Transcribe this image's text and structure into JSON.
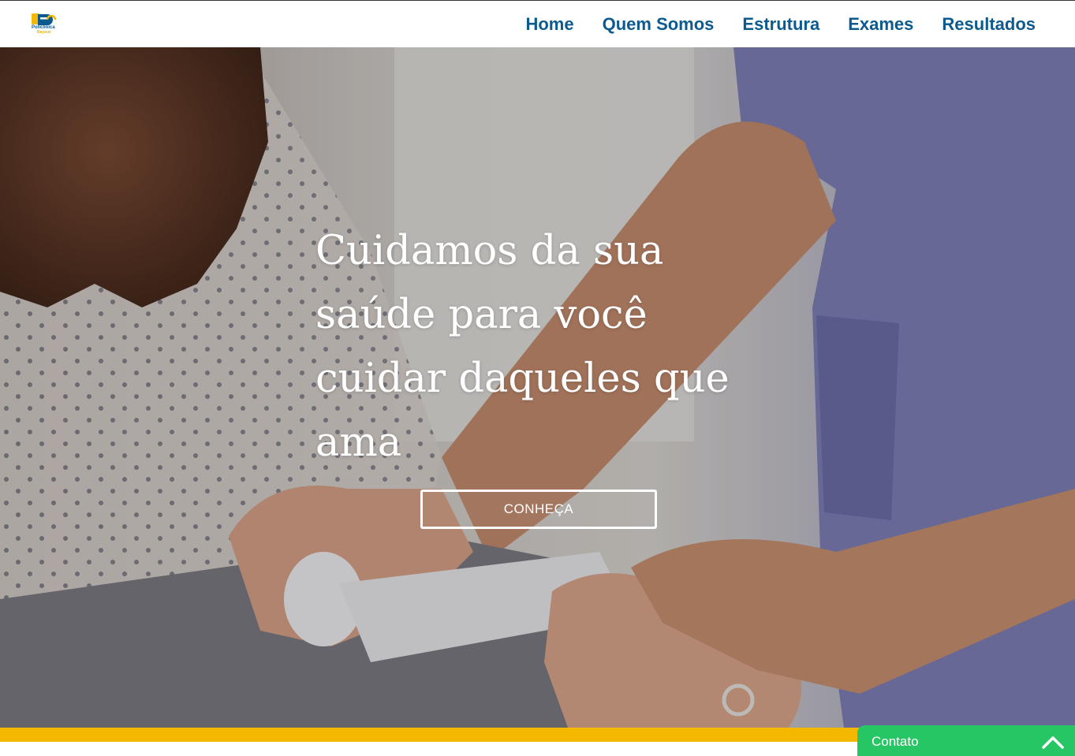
{
  "header": {
    "logo": {
      "name": "Policlínica",
      "tagline": "Bayeux",
      "icon": "logo-icon",
      "colors": [
        "#0c5a8e",
        "#f5b800"
      ]
    },
    "nav": [
      {
        "label": "Home"
      },
      {
        "label": "Quem Somos"
      },
      {
        "label": "Estrutura"
      },
      {
        "label": "Exames"
      },
      {
        "label": "Resultados"
      }
    ]
  },
  "hero": {
    "title": "Cuidamos da sua saúde para você cuidar daqueles que ama",
    "button_label": "CONHEÇA"
  },
  "contact_widget": {
    "label": "Contato",
    "icon": "chevron-up-icon",
    "color": "#27c665"
  },
  "colors": {
    "brand_blue": "#0c5a8e",
    "accent_yellow": "#f5b800"
  }
}
